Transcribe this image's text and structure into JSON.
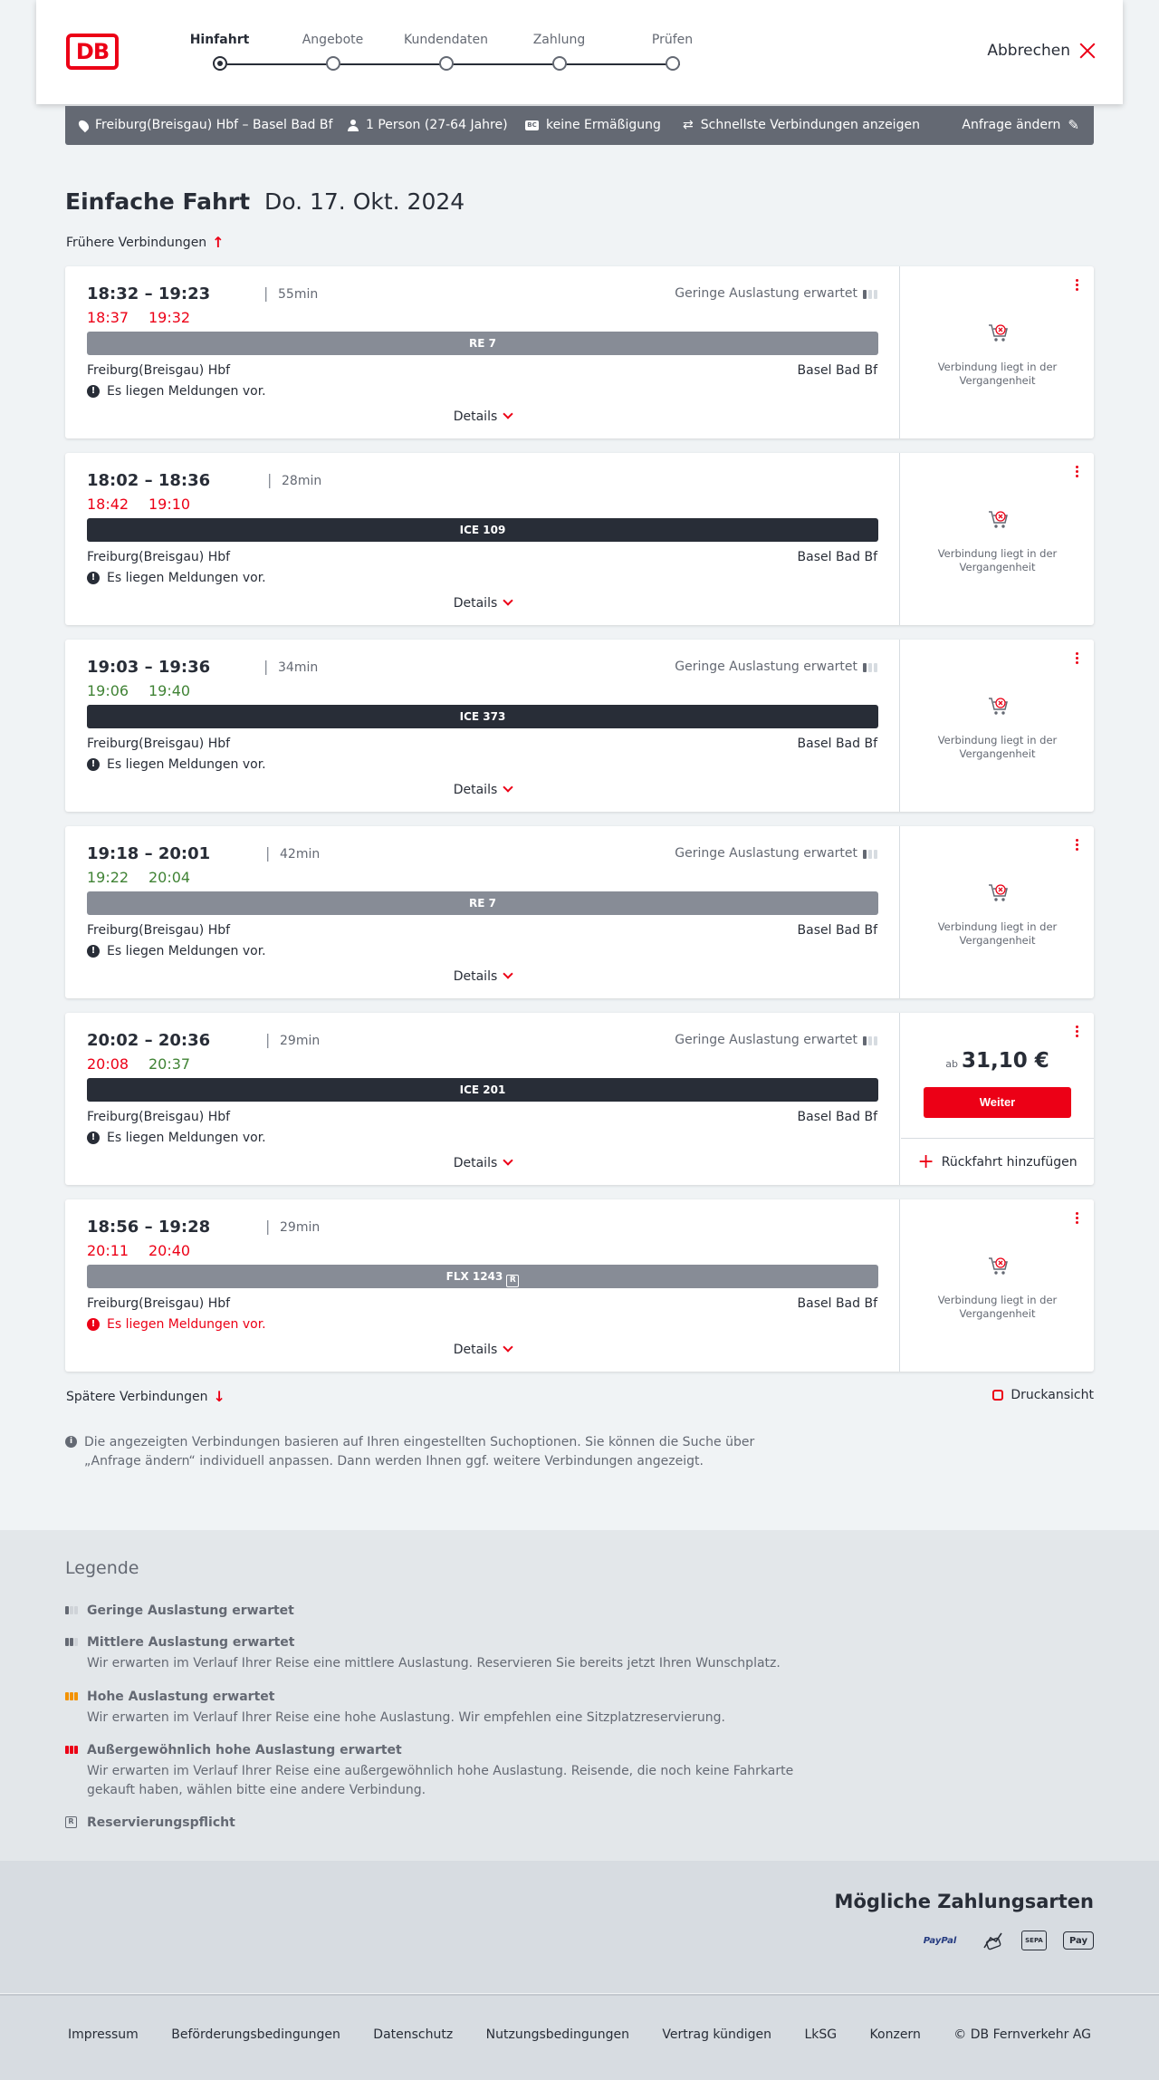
{
  "header": {
    "logo_text": "DB",
    "steps": [
      {
        "label": "Hinfahrt",
        "active": true
      },
      {
        "label": "Angebote",
        "active": false
      },
      {
        "label": "Kundendaten",
        "active": false
      },
      {
        "label": "Zahlung",
        "active": false
      },
      {
        "label": "Prüfen",
        "active": false
      }
    ],
    "cancel_label": "Abbrechen"
  },
  "query": {
    "route": "Freiburg(Breisgau) Hbf – Basel Bad Bf",
    "passengers": "1 Person (27-64 Jahre)",
    "discount_badge": "BC",
    "discount": "keine Ermäßigung",
    "option": "Schnellste Verbindungen anzeigen",
    "change_label": "Anfrage ändern"
  },
  "title": {
    "main": "Einfache Fahrt",
    "date": "Do. 17. Okt. 2024"
  },
  "earlier_label": "Frühere Verbindungen",
  "later_label": "Spätere Verbindungen",
  "print_label": "Druckansicht",
  "details_label": "Details",
  "past_text": "Verbindung liegt in der Vergangenheit",
  "connections": [
    {
      "times": "18:32 – 19:23",
      "duration": "55min",
      "rt_dep": "18:37",
      "rt_dep_color": "red",
      "rt_arr": "19:32",
      "rt_arr_color": "red",
      "occupancy": "Geringe Auslastung erwartet",
      "train": "RE 7",
      "train_style": "grey",
      "from": "Freiburg(Breisgau) Hbf",
      "to": "Basel Bad Bf",
      "message": "Es liegen Meldungen vor.",
      "message_red": false,
      "past": true
    },
    {
      "times": "18:02 – 18:36",
      "duration": "28min",
      "rt_dep": "18:42",
      "rt_dep_color": "red",
      "rt_arr": "19:10",
      "rt_arr_color": "red",
      "occupancy": "",
      "train": "ICE 109",
      "train_style": "dark",
      "from": "Freiburg(Breisgau) Hbf",
      "to": "Basel Bad Bf",
      "message": "Es liegen Meldungen vor.",
      "message_red": false,
      "past": true
    },
    {
      "times": "19:03 – 19:36",
      "duration": "34min",
      "rt_dep": "19:06",
      "rt_dep_color": "green",
      "rt_arr": "19:40",
      "rt_arr_color": "green",
      "occupancy": "Geringe Auslastung erwartet",
      "train": "ICE 373",
      "train_style": "dark",
      "from": "Freiburg(Breisgau) Hbf",
      "to": "Basel Bad Bf",
      "message": "Es liegen Meldungen vor.",
      "message_red": false,
      "past": true
    },
    {
      "times": "19:18 – 20:01",
      "duration": "42min",
      "rt_dep": "19:22",
      "rt_dep_color": "green",
      "rt_arr": "20:04",
      "rt_arr_color": "green",
      "occupancy": "Geringe Auslastung erwartet",
      "train": "RE 7",
      "train_style": "grey",
      "from": "Freiburg(Breisgau) Hbf",
      "to": "Basel Bad Bf",
      "message": "Es liegen Meldungen vor.",
      "message_red": false,
      "past": true
    },
    {
      "times": "20:02 – 20:36",
      "duration": "29min",
      "rt_dep": "20:08",
      "rt_dep_color": "red",
      "rt_arr": "20:37",
      "rt_arr_color": "green",
      "occupancy": "Geringe Auslastung erwartet",
      "train": "ICE 201",
      "train_style": "dark",
      "from": "Freiburg(Breisgau) Hbf",
      "to": "Basel Bad Bf",
      "message": "Es liegen Meldungen vor.",
      "message_red": false,
      "past": false,
      "price_prefix": "ab",
      "price": "31,10 €",
      "button": "Weiter",
      "return_label": "Rückfahrt hinzufügen"
    },
    {
      "times": "18:56 – 19:28",
      "duration": "29min",
      "rt_dep": "20:11",
      "rt_dep_color": "red",
      "rt_arr": "20:40",
      "rt_arr_color": "red",
      "occupancy": "",
      "train": "FLX 1243",
      "train_badge": "R",
      "train_style": "grey",
      "from": "Freiburg(Breisgau) Hbf",
      "to": "Basel Bad Bf",
      "message": "Es liegen Meldungen vor.",
      "message_red": true,
      "past": true
    }
  ],
  "info_text": "Die angezeigten Verbindungen basieren auf Ihren eingestellten Suchoptionen. Sie können die Suche über „Anfrage ändern“ individuell anpassen. Dann werden Ihnen ggf. weitere Verbindungen angezeigt.",
  "legend": {
    "title": "Legende",
    "items": [
      {
        "title": "Geringe Auslastung erwartet",
        "desc": ""
      },
      {
        "title": "Mittlere Auslastung erwartet",
        "desc": "Wir erwarten im Verlauf Ihrer Reise eine mittlere Auslastung. Reservieren Sie bereits jetzt Ihren Wunschplatz."
      },
      {
        "title": "Hohe Auslastung erwartet",
        "desc": "Wir erwarten im Verlauf Ihrer Reise eine hohe Auslastung. Wir empfehlen eine Sitzplatzreservierung."
      },
      {
        "title": "Außergewöhnlich hohe Auslastung erwartet",
        "desc": "Wir erwarten im Verlauf Ihrer Reise eine außergewöhnlich hohe Auslastung. Reisende, die noch keine Fahrkarte gekauft haben, wählen bitte eine andere Verbindung."
      },
      {
        "title": "Reservierungspflicht",
        "desc": ""
      }
    ]
  },
  "payment": {
    "title": "Mögliche Zahlungsarten",
    "paypal": "PayPal",
    "sepa": "SEPA",
    "applepay": "Pay"
  },
  "footer": {
    "links": [
      "Impressum",
      "Beförderungsbedingungen",
      "Datenschutz",
      "Nutzungsbedingungen",
      "Vertrag kündigen",
      "LkSG",
      "Konzern",
      "© DB Fernverkehr AG"
    ]
  },
  "colors": {
    "brand": "#ec0016",
    "late": "#ec0016",
    "ontime": "#408335"
  }
}
